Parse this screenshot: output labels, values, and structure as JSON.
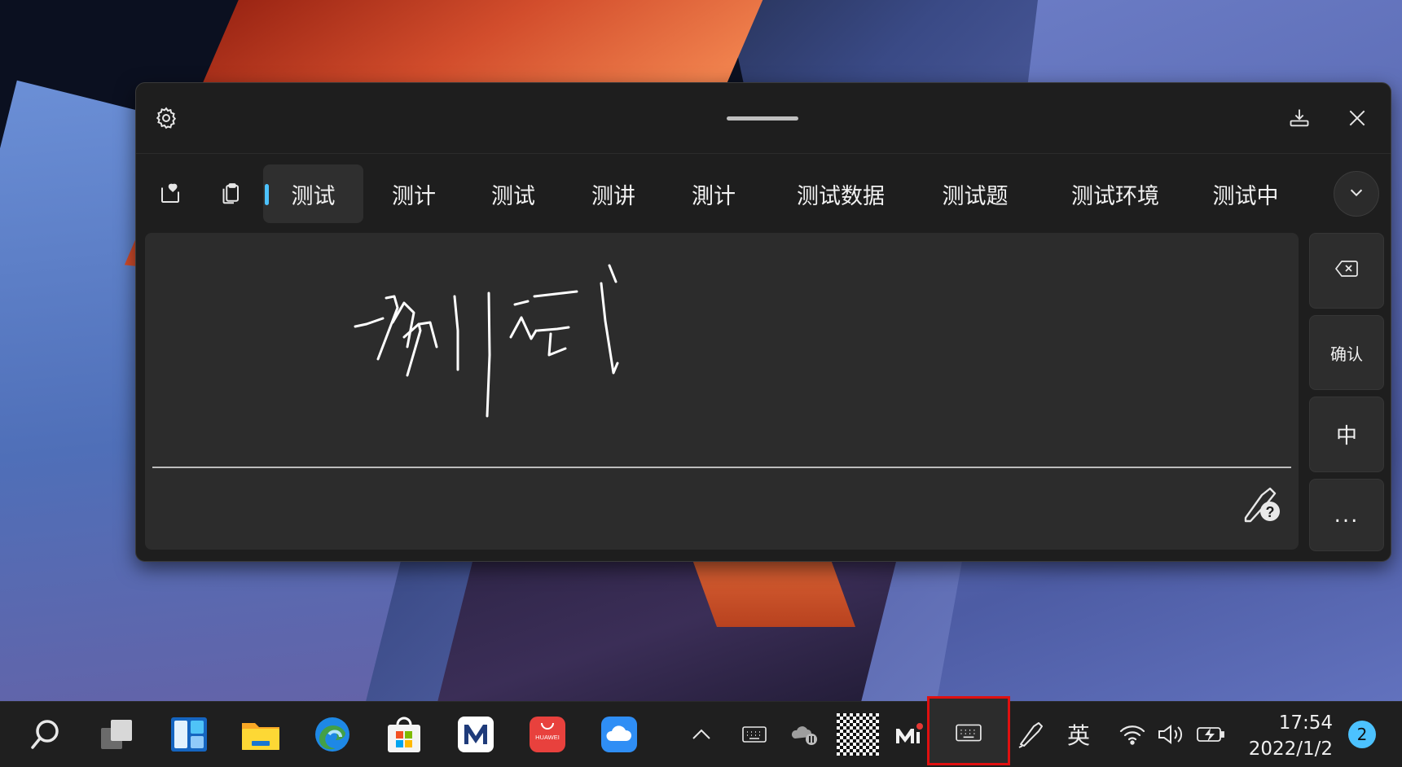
{
  "candidates": {
    "items": [
      "测试",
      "测计",
      "测试",
      "测讲",
      "測计",
      "测试数据",
      "测试题",
      "测试环境",
      "测试中"
    ],
    "selected_index": 0
  },
  "side_buttons": {
    "confirm_label": "确认",
    "lang_label": "中",
    "more_label": "..."
  },
  "taskbar": {
    "ime_mode": "英",
    "time": "17:54",
    "date": "2022/1/2",
    "notification_count": "2",
    "huawei_text": "HUAWEI"
  },
  "colors": {
    "accent": "#4cc2ff",
    "highlight_box": "#e01010",
    "panel_bg": "#1e1e1e",
    "canvas_bg": "#2c2c2c"
  },
  "icons": [
    "settings-icon",
    "dock-icon",
    "close-icon",
    "favorites-icon",
    "clipboard-icon",
    "chevron-down-icon",
    "backspace-icon",
    "handwriting-help-icon",
    "search-icon",
    "task-view-icon",
    "widgets-icon",
    "file-explorer-icon",
    "edge-icon",
    "store-icon",
    "imi-icon",
    "huawei-appgallery-icon",
    "cloud-icon",
    "chevron-up-icon",
    "keyboard-icon",
    "onedrive-paused-icon",
    "wifi-icon",
    "volume-icon",
    "battery-charging-icon",
    "pen-icon"
  ]
}
